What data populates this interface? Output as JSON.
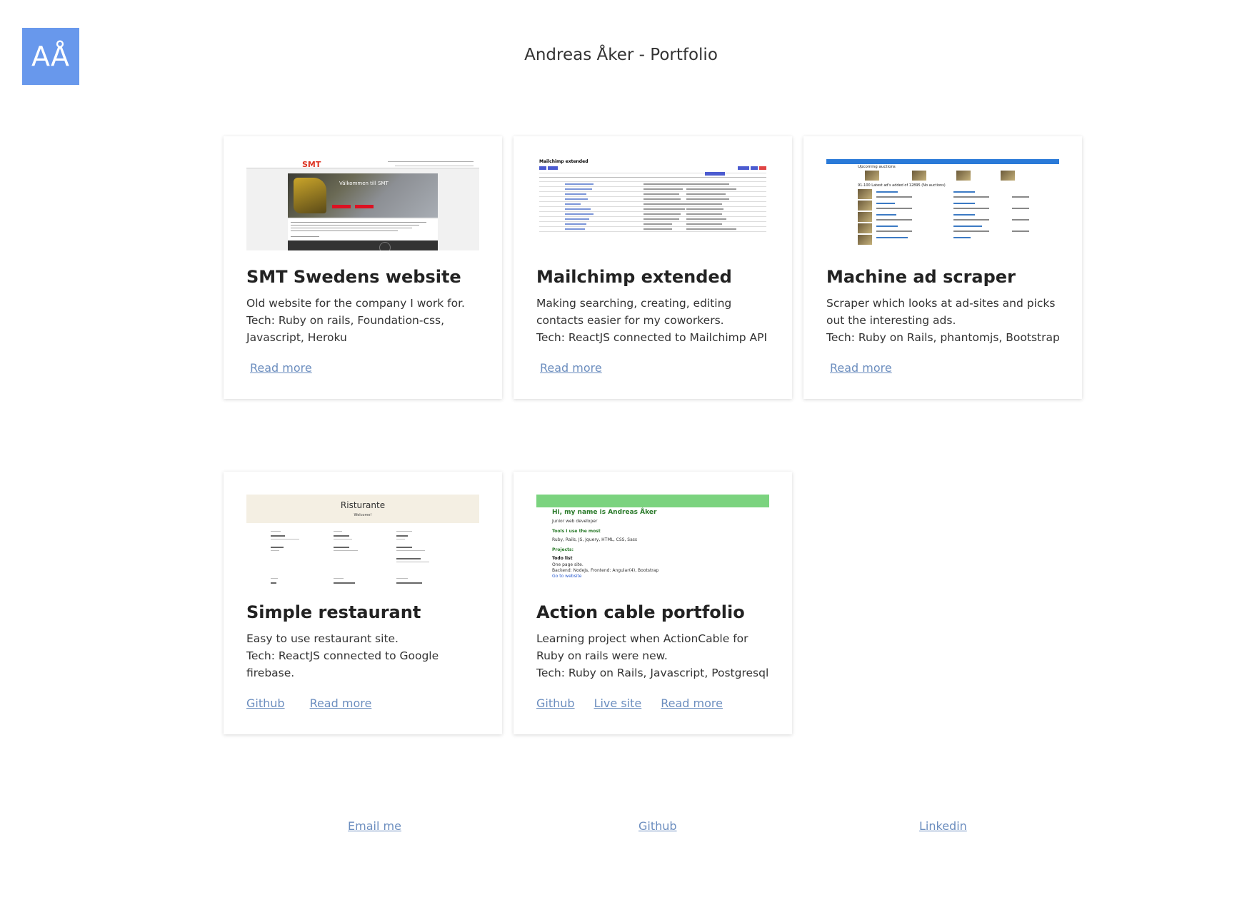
{
  "logo": {
    "text": "AÅ"
  },
  "header": {
    "title": "Andreas Åker - Portfolio"
  },
  "projects": [
    {
      "title": "SMT Swedens website",
      "description": [
        "Old website for the company I work for.",
        "Tech: Ruby on rails, Foundation-css,",
        "Javascript, Heroku"
      ],
      "links": [
        "Read more"
      ],
      "thumb": {
        "logo": "SMT",
        "hero_text": "Välkommen till SMT"
      }
    },
    {
      "title": "Mailchimp extended",
      "description": [
        "Making searching, creating, editing",
        "contacts easier for my coworkers.",
        "Tech: ReactJS connected to Mailchimp API"
      ],
      "links": [
        "Read more"
      ],
      "thumb": {
        "heading": "Mailchimp extended"
      }
    },
    {
      "title": "Machine ad scraper",
      "description": [
        "Scraper which looks at ad-sites and picks",
        "out the interesting ads.",
        "Tech: Ruby on Rails, phantomjs, Bootstrap"
      ],
      "links": [
        "Read more"
      ],
      "thumb": {
        "heading": "Upcoming auctions",
        "subheading": "91-100 Latest ad's added of 12895 (No auctions)"
      }
    },
    {
      "title": "Simple restaurant",
      "description": [
        "Easy to use restaurant site.",
        "Tech: ReactJS connected to Google",
        "firebase."
      ],
      "links": [
        "Github",
        "Read more"
      ],
      "thumb": {
        "heading": "Risturante",
        "welcome": "Welcome!"
      }
    },
    {
      "title": "Action cable portfolio",
      "description": [
        "Learning project when ActionCable for",
        "Ruby on rails were new.",
        "Tech: Ruby on Rails, Javascript, Postgresql"
      ],
      "links": [
        "Github",
        "Live site",
        "Read more"
      ],
      "thumb": {
        "heading": "Hi, my name is Andreas Åker",
        "sub": "Junior web developer",
        "tools_heading": "Tools I use the most",
        "tools": "Ruby, Rails, JS, Jquery, HTML, CSS, Sass",
        "projects_heading": "Projects:",
        "project_name": "Todo list",
        "project_desc": "One page site.",
        "project_tech": "Backend: NodeJs, Frontend: Angular(4), Bootstrap",
        "project_link": "Go to website"
      }
    }
  ],
  "footer": {
    "email": "Email me",
    "github": "Github",
    "linkedin": "Linkedin"
  },
  "colors": {
    "logo_bg": "#6898ec",
    "link": "#6c8ebf",
    "green_band": "#7bd37f"
  }
}
